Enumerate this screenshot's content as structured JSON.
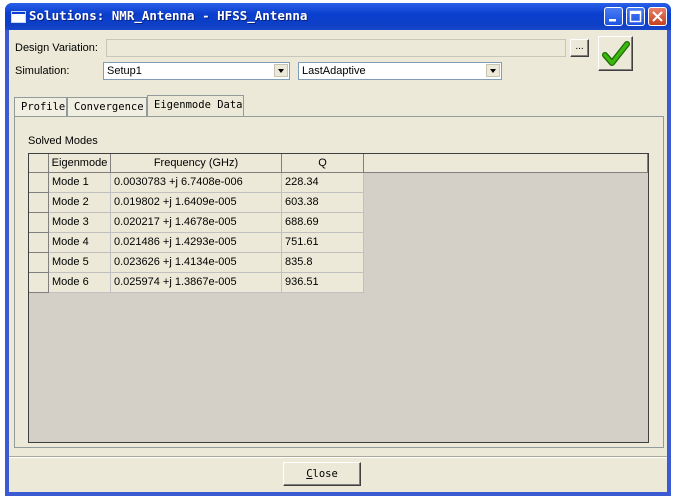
{
  "window": {
    "title": "Solutions: NMR_Antenna - HFSS_Antenna"
  },
  "form": {
    "design_variation_label": "Design Variation:",
    "design_variation_value": "",
    "browse_label": "...",
    "simulation_label": "Simulation:",
    "setup_value": "Setup1",
    "pass_value": "LastAdaptive"
  },
  "tabs": [
    {
      "label": "Profile"
    },
    {
      "label": "Convergence"
    },
    {
      "label": "Eigenmode Data"
    }
  ],
  "active_tab": "Eigenmode Data",
  "solved_modes": {
    "title": "Solved Modes",
    "columns": [
      "Eigenmode",
      "Frequency (GHz)",
      "Q"
    ],
    "rows": [
      {
        "mode": "Mode 1",
        "freq": "0.0030783 +j 6.7408e-006",
        "q": "228.34"
      },
      {
        "mode": "Mode 2",
        "freq": "0.019802 +j 1.6409e-005",
        "q": "603.38"
      },
      {
        "mode": "Mode 3",
        "freq": "0.020217 +j 1.4678e-005",
        "q": "688.69"
      },
      {
        "mode": "Mode 4",
        "freq": "0.021486 +j 1.4293e-005",
        "q": "751.61"
      },
      {
        "mode": "Mode 5",
        "freq": "0.023626 +j 1.4134e-005",
        "q": "835.8"
      },
      {
        "mode": "Mode 6",
        "freq": "0.025974 +j 1.3867e-005",
        "q": "936.51"
      }
    ]
  },
  "footer": {
    "close_prefix": "",
    "close_underlined": "C",
    "close_rest": "lose"
  },
  "colors": {
    "titlebar": "#0a3fcf",
    "client_bg": "#ece9d8",
    "grid_bg": "#d4d0c8",
    "check": "#3cb80f"
  }
}
